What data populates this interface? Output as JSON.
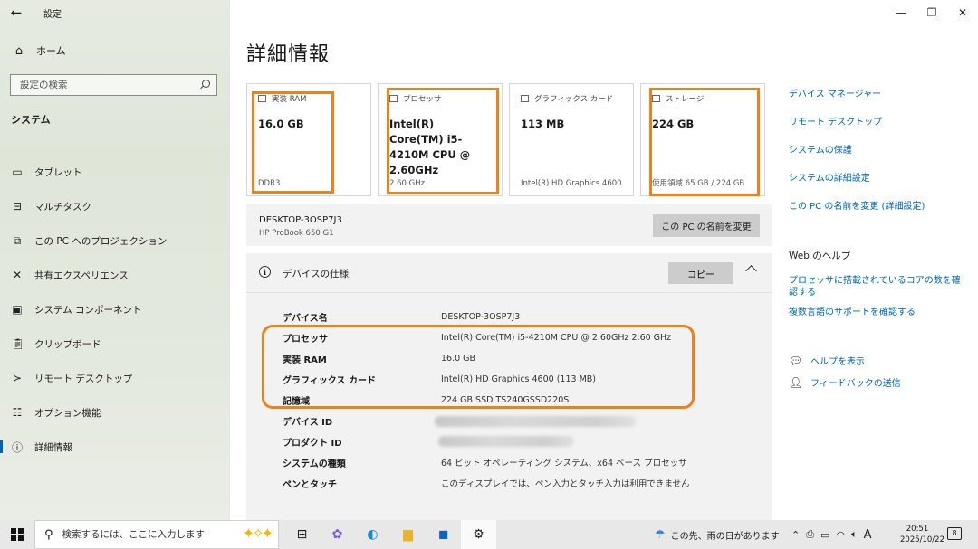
{
  "window": {
    "title": "設定"
  },
  "sidebar": {
    "home_label": "ホーム",
    "search_placeholder": "設定の検索",
    "section_heading": "システム",
    "items": [
      {
        "label": "タブレット",
        "icon": "tablet-icon"
      },
      {
        "label": "マルチタスク",
        "icon": "multitask-icon"
      },
      {
        "label": "この PC へのプロジェクション",
        "icon": "projection-icon"
      },
      {
        "label": "共有エクスペリエンス",
        "icon": "shared-experience-icon"
      },
      {
        "label": "システム コンポーネント",
        "icon": "system-components-icon"
      },
      {
        "label": "クリップボード",
        "icon": "clipboard-icon"
      },
      {
        "label": "リモート デスクトップ",
        "icon": "remote-desktop-icon"
      },
      {
        "label": "オプション機能",
        "icon": "optional-features-icon"
      },
      {
        "label": "詳細情報",
        "icon": "about-icon",
        "active": true
      }
    ]
  },
  "main": {
    "title": "詳細情報",
    "cards": [
      {
        "head": "実装 RAM",
        "value": "16.0 GB",
        "sub": "DDR3",
        "icon": "ram-icon"
      },
      {
        "head": "プロセッサ",
        "value": "Intel(R) Core(TM) i5-4210M CPU @ 2.60GHz",
        "sub": "2.60 GHz",
        "icon": "processor-icon"
      },
      {
        "head": "グラフィックス カード",
        "value": "113 MB",
        "sub": "Intel(R) HD Graphics 4600",
        "icon": "graphics-icon"
      },
      {
        "head": "ストレージ",
        "value": "224 GB",
        "sub": "使用領域 65 GB / 224 GB",
        "icon": "storage-icon"
      }
    ],
    "device": {
      "name": "DESKTOP-3OSP7J3",
      "model": "HP ProBook 650 G1",
      "rename_label": "この PC の名前を変更"
    },
    "specs": {
      "title": "デバイスの仕様",
      "copy_label": "コピー",
      "rows": [
        {
          "key": "デバイス名",
          "value": "DESKTOP-3OSP7J3"
        },
        {
          "key": "プロセッサ",
          "value": "Intel(R) Core(TM) i5-4210M CPU @ 2.60GHz   2.60 GHz"
        },
        {
          "key": "実装 RAM",
          "value": "16.0 GB"
        },
        {
          "key": "グラフィックス カード",
          "value": "Intel(R) HD Graphics 4600 (113 MB)"
        },
        {
          "key": "記憶域",
          "value": "224 GB SSD TS240GSSD220S"
        },
        {
          "key": "デバイス ID",
          "value": ""
        },
        {
          "key": "プロダクト ID",
          "value": ""
        },
        {
          "key": "システムの種類",
          "value": "64 ビット オペレーティング システム、x64 ベース プロセッサ"
        },
        {
          "key": "ペンとタッチ",
          "value": "このディスプレイでは、ペン入力とタッチ入力は利用できません"
        }
      ]
    }
  },
  "related": {
    "links": [
      "デバイス マネージャー",
      "リモート デスクトップ",
      "システムの保護",
      "システムの詳細設定",
      "この PC の名前を変更 (詳細設定)"
    ],
    "web_help_heading": "Web のヘルプ",
    "web_links": [
      "プロセッサに搭載されているコアの数を確認する",
      "複数言語のサポートを確認する"
    ],
    "help_label": "ヘルプを表示",
    "feedback_label": "フィードバックの送信"
  },
  "taskbar": {
    "search_placeholder": "検索するには、ここに入力します",
    "weather_text": "この先、雨の日があります",
    "time": "20:51",
    "date": "2025/10/22",
    "ime_label": "A",
    "notification_count": "8"
  },
  "colors": {
    "accent": "#0063b1",
    "highlight": "#f0801a"
  }
}
